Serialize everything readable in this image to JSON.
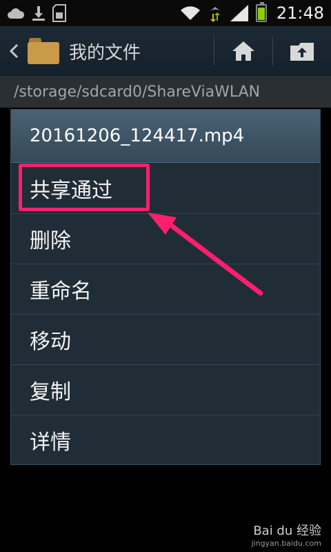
{
  "status_bar": {
    "time": "21:48",
    "icons": [
      "cloud-icon",
      "download-icon",
      "sd-card-icon",
      "wifi-icon",
      "data-arrows-icon",
      "signal-icon",
      "battery-icon"
    ],
    "battery_color": "#8bd000"
  },
  "action_bar": {
    "title": "我的文件",
    "icons": [
      "back-icon",
      "folder-icon",
      "home-icon",
      "up-folder-icon"
    ]
  },
  "path_bar": {
    "path": "/storage/sdcard0/ShareViaWLAN"
  },
  "dialog": {
    "title": "20161206_124417.mp4",
    "items": [
      {
        "label": "共享通过"
      },
      {
        "label": "删除"
      },
      {
        "label": "重命名"
      },
      {
        "label": "移动"
      },
      {
        "label": "复制"
      },
      {
        "label": "详情"
      }
    ]
  },
  "annotation": {
    "highlight_color": "#ff1f6d"
  },
  "watermark": {
    "brand": "Bai du 经验",
    "site": "jingyan.baidu.com"
  }
}
